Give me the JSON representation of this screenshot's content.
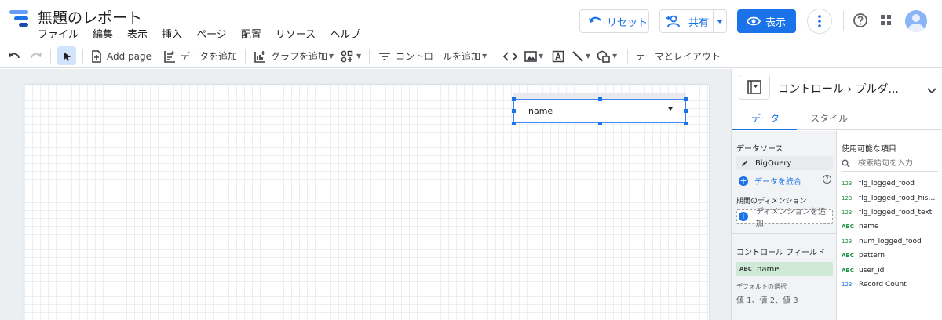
{
  "header": {
    "title": "無題のレポート",
    "menu": [
      "ファイル",
      "編集",
      "表示",
      "挿入",
      "ページ",
      "配置",
      "リソース",
      "ヘルプ"
    ],
    "reset_label": "リセット",
    "share_label": "共有",
    "view_label": "表示"
  },
  "toolbar": {
    "add_page": "Add page",
    "add_data": "データを追加",
    "add_chart": "グラフを追加",
    "add_control": "コントロールを追加",
    "theme_layout": "テーマとレイアウト"
  },
  "canvas": {
    "dropdown_value": "name"
  },
  "panel": {
    "title": "コントロール › プルダ...",
    "tabs": {
      "data": "データ",
      "style": "スタイル"
    },
    "data_source": {
      "heading": "データソース",
      "source_name": "BigQuery",
      "blend_label": "データを統合"
    },
    "date_dimension": {
      "heading": "期間のディメンション",
      "add_label": "ディメンションを追加"
    },
    "control_field": {
      "heading": "コントロール フィールド",
      "field_type": "ABC",
      "field_name": "name",
      "default_label": "デフォルトの選択",
      "default_values": "値 1、値 2、値 3"
    },
    "available": {
      "heading": "使用可能な項目",
      "search_placeholder": "検索語句を入力",
      "fields": [
        {
          "type": "123",
          "name": "flg_logged_food"
        },
        {
          "type": "123",
          "name": "flg_logged_food_history"
        },
        {
          "type": "123",
          "name": "flg_logged_food_text"
        },
        {
          "type": "ABC",
          "name": "name"
        },
        {
          "type": "123",
          "name": "num_logged_food"
        },
        {
          "type": "ABC",
          "name": "pattern"
        },
        {
          "type": "ABC",
          "name": "user_id"
        },
        {
          "type": "123",
          "name": "Record Count"
        }
      ]
    }
  },
  "colors": {
    "accent": "#1a73e8",
    "field_chip": "#ceead6"
  }
}
